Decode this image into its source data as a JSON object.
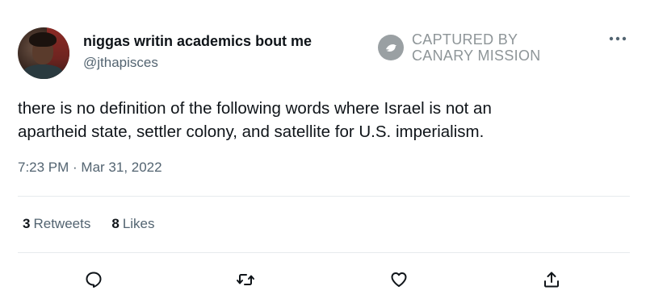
{
  "author": {
    "display_name": "niggas writin academics bout me",
    "handle": "@jthapisces"
  },
  "watermark": {
    "line1": "CAPTURED BY",
    "line2": "CANARY MISSION"
  },
  "tweet": {
    "text_line1": "there is no definition of the following words where Israel is not an",
    "text_line2": "apartheid state, settler colony, and satellite for U.S. imperialism.",
    "timestamp": "7:23 PM · Mar 31, 2022"
  },
  "stats": {
    "retweets_count": "3",
    "retweets_label": "Retweets",
    "likes_count": "8",
    "likes_label": "Likes"
  },
  "icons": {
    "more": "more-horizontal-icon",
    "reply": "reply-icon",
    "retweet": "retweet-icon",
    "like": "heart-icon",
    "share": "share-icon",
    "watermark": "bird-logo-icon"
  },
  "colors": {
    "text_primary": "#0f1419",
    "text_secondary": "#536471",
    "watermark": "#8e9598",
    "divider": "#e6eaed"
  }
}
